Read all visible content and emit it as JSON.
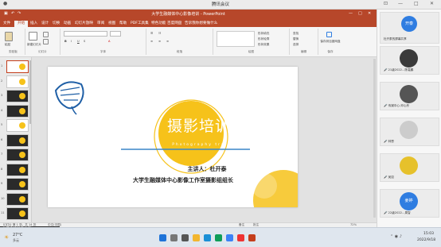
{
  "meeting": {
    "title": "腾讯会议",
    "speaker": "正在讲话："
  },
  "ppt": {
    "title": "大学生融媒体中心影像培训 - PowerPoint",
    "tabs": [
      "文件",
      "开始",
      "插入",
      "设计",
      "切换",
      "动画",
      "幻灯片放映",
      "审阅",
      "视图",
      "帮助",
      "PDF工具集",
      "特色功能",
      "百度网盘",
      "告诉我你想要做什么"
    ],
    "ribbon": {
      "paste": "粘贴",
      "new_slide": "新建幻灯片",
      "groups": [
        "剪贴板",
        "幻灯片",
        "字体",
        "段落",
        "绘图",
        "编辑",
        "保存"
      ],
      "shape_fill": "形状填充",
      "shape_outline": "形状轮廓",
      "shape_effect": "形状效果",
      "find": "查找",
      "replace": "替换",
      "select": "选择",
      "save_baidu": "保存到百度网盘"
    },
    "slide_count": 14,
    "status": {
      "slide_pos": "幻灯片 第 1 张，共 14 张",
      "lang": "中文(中国)",
      "notes": "备注",
      "comments": "批注",
      "zoom": "72%"
    }
  },
  "slide": {
    "title": "摄影培训",
    "subtitle": "Photography training",
    "speaker_line": "主讲人：杜开泰",
    "org_line": "大学生融媒体中心影像工作室摄影组组长",
    "accent": "#f6c21a"
  },
  "participants": {
    "host_badge": "开泰",
    "host_name": "杜开泰的屏幕共享",
    "list": [
      {
        "name": "21级2022…陈嘉鹏",
        "avatar": "#3a3a3a"
      },
      {
        "name": "传媒中心-邓心彤",
        "avatar": "#555555"
      },
      {
        "name": "林恩",
        "avatar": "#cccccc"
      },
      {
        "name": "吴如",
        "avatar": "#e6c12b"
      },
      {
        "name": "22级2022…周智",
        "avatar": "#2f7de1",
        "badge": "姜婷"
      }
    ]
  },
  "sharing_banner": "杜开泰的屏幕共享",
  "taskbar": {
    "weather_temp": "27°C",
    "weather_desc": "多云",
    "time": "15:03",
    "date": "2022/9/18"
  }
}
